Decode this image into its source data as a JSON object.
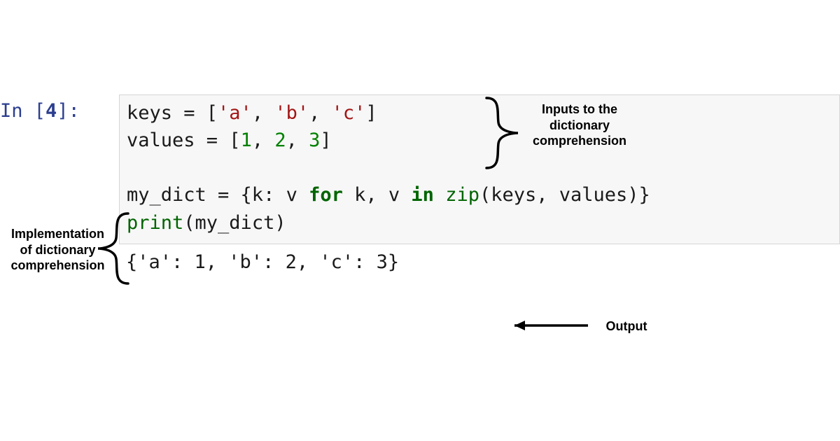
{
  "prompt": {
    "in_label": "In ",
    "open": "[",
    "num": "4",
    "close": "]",
    "colon": ":"
  },
  "code": {
    "line1": {
      "pre": "keys = [",
      "s1": "'a'",
      "c1": ", ",
      "s2": "'b'",
      "c2": ", ",
      "s3": "'c'",
      "end": "]"
    },
    "line2": {
      "pre": "values = [",
      "n1": "1",
      "c1": ", ",
      "n2": "2",
      "c2": ", ",
      "n3": "3",
      "end": "]"
    },
    "blank": " ",
    "line4": {
      "a": "my_dict = {k: v ",
      "kw1": "for",
      "b": " k, v ",
      "kw2": "in",
      "c": " ",
      "zip": "zip",
      "d": "(keys, values)}"
    },
    "line5": {
      "print": "print",
      "rest": "(my_dict)"
    }
  },
  "output": "{'a': 1, 'b': 2, 'c': 3}",
  "annotations": {
    "inputs_line1": "Inputs to the",
    "inputs_line2": "dictionary",
    "inputs_line3": "comprehension",
    "impl_line1": "Implementation",
    "impl_line2": "of dictionary",
    "impl_line3": "comprehension",
    "output": "Output"
  }
}
